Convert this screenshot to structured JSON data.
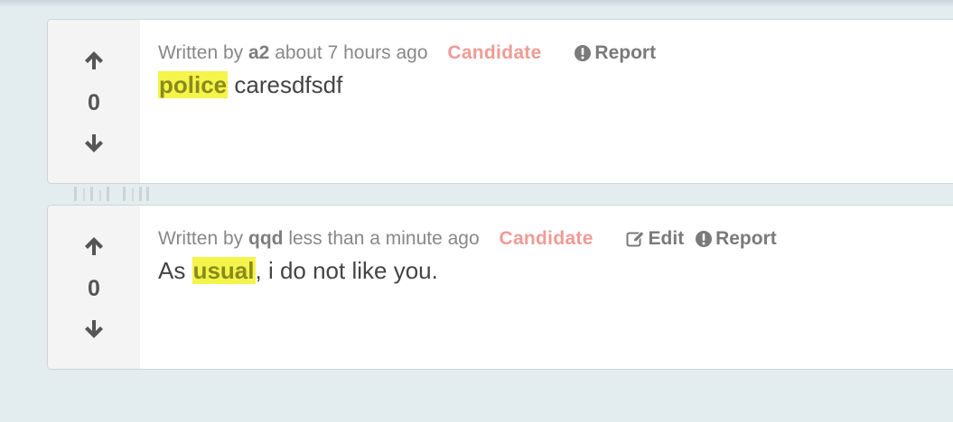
{
  "comments": [
    {
      "score": "0",
      "written_by": "Written by",
      "author": "a2",
      "time": "about 7 hours ago",
      "status": "Candidate",
      "report_label": "Report",
      "highlight": "police",
      "text_after": " caresdfsdf"
    },
    {
      "score": "0",
      "written_by": "Written by",
      "author": "qqd",
      "time": "less than a minute ago",
      "status": "Candidate",
      "edit_label": "Edit",
      "report_label": "Report",
      "text_before": "As ",
      "highlight": "usual",
      "text_after": ", i do not like you."
    }
  ],
  "colors": {
    "background": "#e3ecee",
    "status": "#f09b96",
    "highlight": "#f4f44a",
    "vote_panel": "#f4f4f4"
  },
  "icons": {
    "upvote": "arrow-up-icon",
    "downvote": "arrow-down-icon",
    "report": "exclamation-circle-icon",
    "edit": "edit-icon"
  }
}
